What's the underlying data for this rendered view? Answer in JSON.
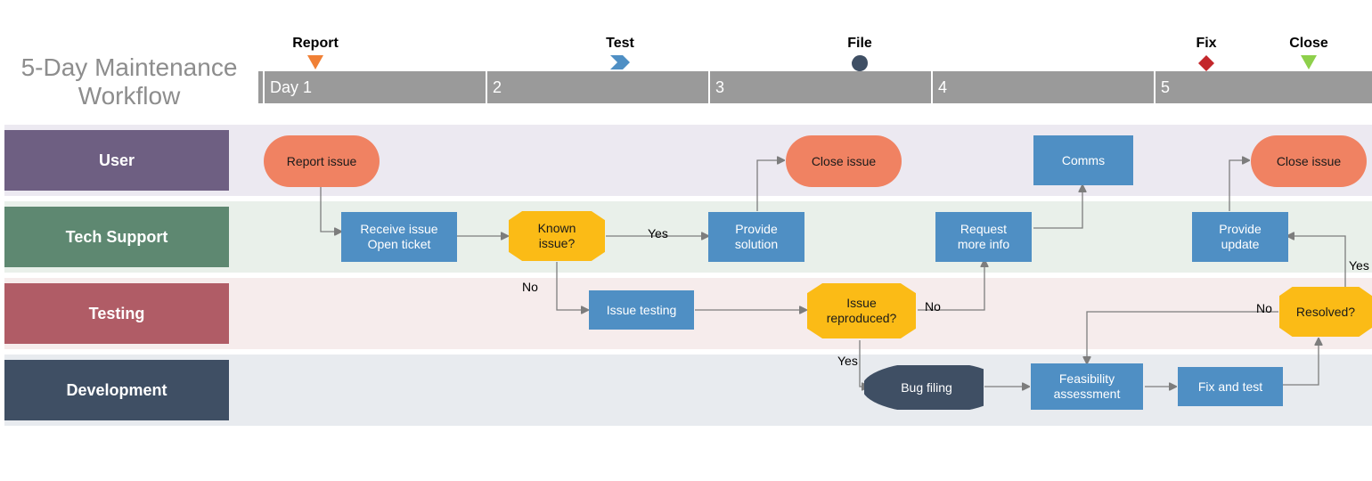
{
  "chart_data": {
    "type": "swimlane_flowchart",
    "title": "5-Day Maintenance Workflow",
    "timeline": {
      "unit": "Day",
      "labels": [
        "Day 1",
        "2",
        "3",
        "4",
        "5"
      ],
      "milestones": [
        {
          "name": "Report",
          "icon": "triangle-down",
          "color": "#f08036",
          "day": 1
        },
        {
          "name": "Test",
          "icon": "chevron-right",
          "color": "#4f8fc4",
          "day": 2
        },
        {
          "name": "File",
          "icon": "drop",
          "color": "#3f4f64",
          "day": 3
        },
        {
          "name": "Fix",
          "icon": "diamond",
          "color": "#c3272b",
          "day": 5
        },
        {
          "name": "Close",
          "icon": "triangle-down",
          "color": "#8ed04b",
          "day": 5
        }
      ]
    },
    "lanes": [
      {
        "name": "User",
        "color": "#6e5f82",
        "bg": "#ece9f1"
      },
      {
        "name": "Tech Support",
        "color": "#5e8871",
        "bg": "#e9f0ea"
      },
      {
        "name": "Testing",
        "color": "#b05c66",
        "bg": "#f6ecec"
      },
      {
        "name": "Development",
        "color": "#3f4f64",
        "bg": "#e8ebef"
      }
    ],
    "nodes": [
      {
        "id": "report_issue",
        "lane": "User",
        "day": 1,
        "type": "terminator",
        "label": "Report issue"
      },
      {
        "id": "receive",
        "lane": "Tech Support",
        "day": 1,
        "type": "process",
        "label": "Receive issue\nOpen ticket"
      },
      {
        "id": "known",
        "lane": "Tech Support",
        "day": 2,
        "type": "decision",
        "label": "Known issue?"
      },
      {
        "id": "provide_solution",
        "lane": "Tech Support",
        "day": 3,
        "type": "process",
        "label": "Provide solution"
      },
      {
        "id": "close1",
        "lane": "User",
        "day": 3,
        "type": "terminator",
        "label": "Close issue"
      },
      {
        "id": "testing",
        "lane": "Testing",
        "day": 2,
        "type": "process",
        "label": "Issue testing"
      },
      {
        "id": "reproduced",
        "lane": "Testing",
        "day": 3,
        "type": "decision",
        "label": "Issue reproduced?"
      },
      {
        "id": "request_info",
        "lane": "Tech Support",
        "day": 4,
        "type": "process",
        "label": "Request more info"
      },
      {
        "id": "comms",
        "lane": "User",
        "day": 4,
        "type": "process",
        "label": "Comms"
      },
      {
        "id": "bug",
        "lane": "Development",
        "day": 3,
        "type": "data",
        "label": "Bug filing"
      },
      {
        "id": "feas",
        "lane": "Development",
        "day": 4,
        "type": "process",
        "label": "Feasibility assessment"
      },
      {
        "id": "fix",
        "lane": "Development",
        "day": 5,
        "type": "process",
        "label": "Fix and test"
      },
      {
        "id": "resolved",
        "lane": "Testing",
        "day": 5,
        "type": "decision",
        "label": "Resolved?"
      },
      {
        "id": "update",
        "lane": "Tech Support",
        "day": 5,
        "type": "process",
        "label": "Provide update"
      },
      {
        "id": "close2",
        "lane": "User",
        "day": 5,
        "type": "terminator",
        "label": "Close issue"
      }
    ],
    "edges": [
      {
        "from": "report_issue",
        "to": "receive",
        "label": ""
      },
      {
        "from": "receive",
        "to": "known",
        "label": ""
      },
      {
        "from": "known",
        "to": "provide_solution",
        "label": "Yes"
      },
      {
        "from": "provide_solution",
        "to": "close1",
        "label": ""
      },
      {
        "from": "known",
        "to": "testing",
        "label": "No"
      },
      {
        "from": "testing",
        "to": "reproduced",
        "label": ""
      },
      {
        "from": "reproduced",
        "to": "request_info",
        "label": "No"
      },
      {
        "from": "request_info",
        "to": "comms",
        "label": ""
      },
      {
        "from": "reproduced",
        "to": "bug",
        "label": "Yes"
      },
      {
        "from": "bug",
        "to": "feas",
        "label": ""
      },
      {
        "from": "feas",
        "to": "fix",
        "label": ""
      },
      {
        "from": "fix",
        "to": "resolved",
        "label": ""
      },
      {
        "from": "resolved",
        "to": "update",
        "label": "Yes"
      },
      {
        "from": "resolved",
        "to": "feas",
        "label": "No"
      },
      {
        "from": "update",
        "to": "close2",
        "label": ""
      }
    ]
  },
  "title_line1": "5-Day Maintenance",
  "title_line2": "Workflow",
  "tl": {
    "d1": "Day 1",
    "d2": "2",
    "d3": "3",
    "d4": "4",
    "d5": "5"
  },
  "ms": {
    "report": "Report",
    "test": "Test",
    "file": "File",
    "fix": "Fix",
    "close": "Close"
  },
  "lanes": {
    "user": "User",
    "tech": "Tech Support",
    "testing": "Testing",
    "dev": "Development"
  },
  "n": {
    "report": "Report issue",
    "receive1": "Receive issue",
    "receive2": "Open ticket",
    "known1": "Known",
    "known2": "issue?",
    "prov1": "Provide",
    "prov2": "solution",
    "close_issue": "Close issue",
    "testing": "Issue testing",
    "repro1": "Issue",
    "repro2": "reproduced?",
    "req1": "Request",
    "req2": "more info",
    "comms": "Comms",
    "bug": "Bug filing",
    "feas1": "Feasibility",
    "feas2": "assessment",
    "fix": "Fix and test",
    "resolved": "Resolved?",
    "upd1": "Provide",
    "upd2": "update"
  },
  "yes": "Yes",
  "no": "No"
}
